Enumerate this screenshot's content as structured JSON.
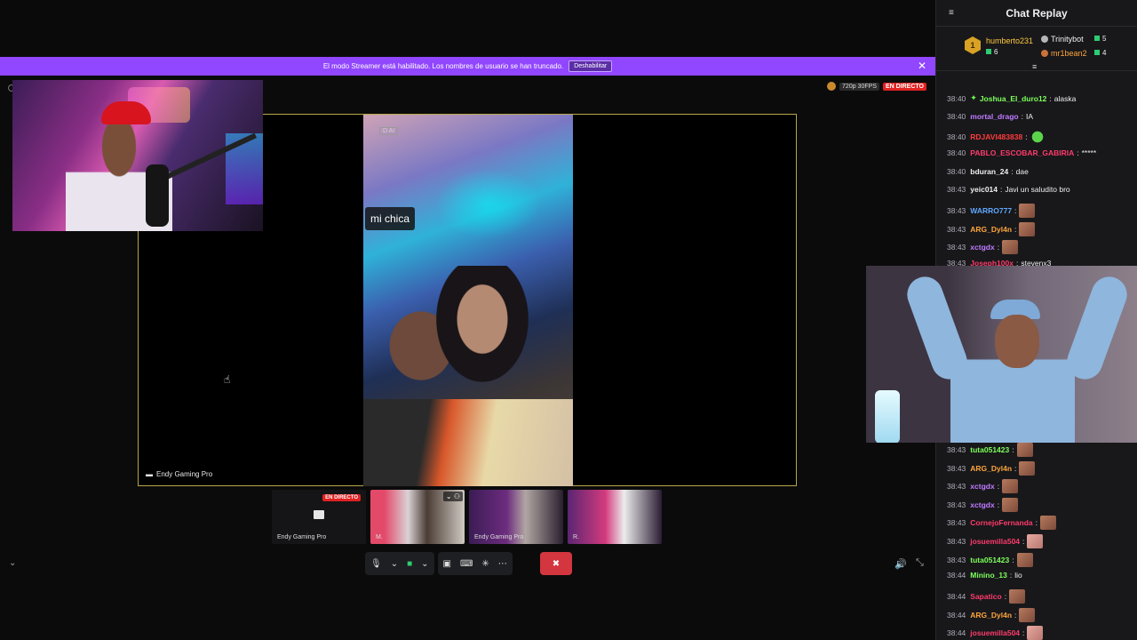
{
  "banner": {
    "text": "El modo Streamer está habilitado. Los nombres de usuario se han truncado.",
    "disable_label": "Deshabilitar",
    "close_glyph": "✕"
  },
  "stream": {
    "quality": "720p 30FPS",
    "live_label": "EN DIRECTO"
  },
  "stage": {
    "label": "Endy Gaming Pro",
    "caption": "mi chica",
    "ai_tag": "D AI"
  },
  "thumbs": [
    {
      "label": "Endy Gaming Pro",
      "live": "EN DIRECTO"
    },
    {
      "label": "M."
    },
    {
      "label": "Endy Gaming Pro"
    },
    {
      "label": "R."
    }
  ],
  "chat": {
    "title": "Chat Replay",
    "leaders": {
      "first": {
        "rank": "1",
        "name": "humberto231",
        "count": "6"
      },
      "second": {
        "name": "Trinitybot",
        "count": "5"
      },
      "third": {
        "name": "mr1bean2",
        "count": "4"
      }
    },
    "messages": [
      {
        "ts": "38:40",
        "user": "Joshua_El_duro12",
        "color": "#7dff5a",
        "text": "alaska",
        "emote": ""
      },
      {
        "ts": "38:40",
        "user": "mortal_drago",
        "color": "#bf7bff",
        "text": "IA",
        "emote": ""
      },
      {
        "ts": "38:40",
        "user": "RDJAVI483838",
        "color": "#ff3b3b",
        "text": "",
        "emote": "green"
      },
      {
        "ts": "38:40",
        "user": "PABLO_ESCOBAR_GABIRIA",
        "color": "#ff3b6b",
        "text": "*****",
        "emote": ""
      },
      {
        "ts": "38:40",
        "user": "bduran_24",
        "color": "#efeff1",
        "text": "dae",
        "emote": ""
      },
      {
        "ts": "38:43",
        "user": "yeic014",
        "color": "#efeff1",
        "text": "Javi un saludito bro",
        "emote": ""
      },
      {
        "ts": "38:43",
        "user": "WARRO777",
        "color": "#5fa8ff",
        "text": "",
        "emote": "face"
      },
      {
        "ts": "38:43",
        "user": "ARG_Dyl4n",
        "color": "#ffa53b",
        "text": "",
        "emote": "face"
      },
      {
        "ts": "38:43",
        "user": "xctgdx",
        "color": "#bf7bff",
        "text": "",
        "emote": "face"
      },
      {
        "ts": "38:43",
        "user": "Joseph100x",
        "color": "#ff3b6b",
        "text": "stevenx3",
        "emote": ""
      },
      {
        "ts": "38:43",
        "user": "tuta051423",
        "color": "#7dff5a",
        "text": "",
        "emote": "face"
      },
      {
        "ts": "38:43",
        "user": "ARG_Dyl4n",
        "color": "#ffa53b",
        "text": "",
        "emote": "face"
      },
      {
        "ts": "38:43",
        "user": "xctgdx",
        "color": "#bf7bff",
        "text": "",
        "emote": "face"
      },
      {
        "ts": "38:43",
        "user": "xctgdx",
        "color": "#bf7bff",
        "text": "",
        "emote": "face"
      },
      {
        "ts": "38:43",
        "user": "CornejoFernanda",
        "color": "#ff3b6b",
        "text": "",
        "emote": "face"
      },
      {
        "ts": "38:43",
        "user": "josuemilla504",
        "color": "#ff3b6b",
        "text": "",
        "emote": "pink"
      },
      {
        "ts": "38:43",
        "user": "tuta051423",
        "color": "#7dff5a",
        "text": "",
        "emote": "face"
      },
      {
        "ts": "38:44",
        "user": "Minino_13",
        "color": "#7dff5a",
        "text": "lio",
        "emote": ""
      },
      {
        "ts": "38:44",
        "user": "Sapatico",
        "color": "#ff3b6b",
        "text": "",
        "emote": "face"
      },
      {
        "ts": "38:44",
        "user": "ARG_Dyl4n",
        "color": "#ffa53b",
        "text": "",
        "emote": "face"
      },
      {
        "ts": "38:44",
        "user": "josuemilla504",
        "color": "#ff3b6b",
        "text": "",
        "emote": "pink"
      }
    ]
  }
}
